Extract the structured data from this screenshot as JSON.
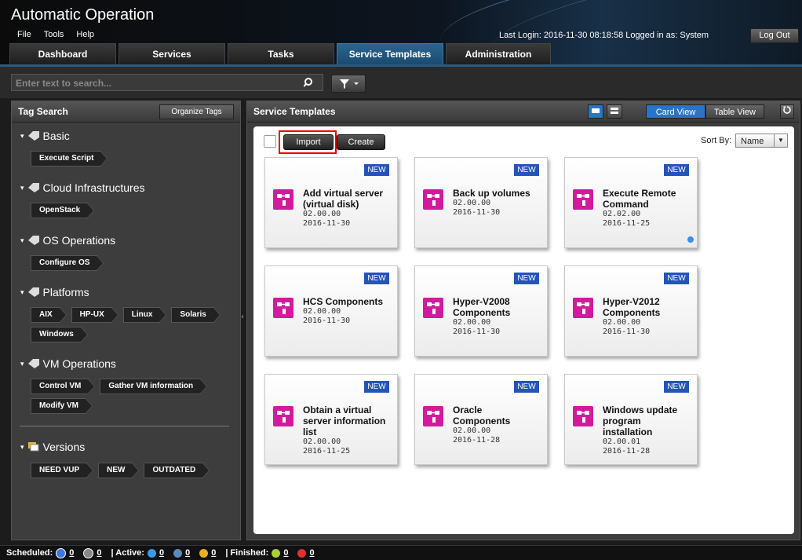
{
  "app": {
    "title": "Automatic Operation",
    "menu": [
      "File",
      "Tools",
      "Help"
    ],
    "last_login": "Last Login: 2016-11-30 08:18:58  Logged in as: System",
    "logout_label": "Log Out"
  },
  "tabs": [
    {
      "label": "Dashboard",
      "active": false
    },
    {
      "label": "Services",
      "active": false
    },
    {
      "label": "Tasks",
      "active": false
    },
    {
      "label": "Service Templates",
      "active": true
    },
    {
      "label": "Administration",
      "active": false
    }
  ],
  "search": {
    "placeholder": "Enter text to search..."
  },
  "tag_search": {
    "title": "Tag Search",
    "organize_label": "Organize Tags",
    "categories": [
      {
        "name": "Basic",
        "tags": [
          "Execute Script"
        ]
      },
      {
        "name": "Cloud Infrastructures",
        "tags": [
          "OpenStack"
        ]
      },
      {
        "name": "OS Operations",
        "tags": [
          "Configure OS"
        ]
      },
      {
        "name": "Platforms",
        "tags": [
          "AIX",
          "HP-UX",
          "Linux",
          "Solaris",
          "Windows"
        ]
      },
      {
        "name": "VM Operations",
        "tags": [
          "Control VM",
          "Gather VM information",
          "Modify VM"
        ]
      }
    ],
    "versions": {
      "name": "Versions",
      "tags": [
        "NEED VUP",
        "NEW",
        "OUTDATED"
      ]
    }
  },
  "templates": {
    "title": "Service Templates",
    "card_view_label": "Card View",
    "table_view_label": "Table View",
    "import_label": "Import",
    "create_label": "Create",
    "sort_by_label": "Sort By:",
    "sort_value": "Name",
    "cards": [
      {
        "badge": "NEW",
        "title": "Add virtual server (virtual disk)",
        "version": "02.00.00",
        "date": "2016-11-30",
        "dot": false
      },
      {
        "badge": "NEW",
        "title": "Back up volumes",
        "version": "02.00.00",
        "date": "2016-11-30",
        "dot": false
      },
      {
        "badge": "NEW",
        "title": "Execute Remote Command",
        "version": "02.02.00",
        "date": "2016-11-25",
        "dot": true
      },
      {
        "badge": "NEW",
        "title": "HCS Components",
        "version": "02.00.00",
        "date": "2016-11-30",
        "dot": false
      },
      {
        "badge": "NEW",
        "title": "Hyper-V2008 Components",
        "version": "02.00.00",
        "date": "2016-11-30",
        "dot": false
      },
      {
        "badge": "NEW",
        "title": "Hyper-V2012 Components",
        "version": "02.00.00",
        "date": "2016-11-30",
        "dot": false
      },
      {
        "badge": "NEW",
        "title": "Obtain a virtual server information list",
        "version": "02.00.00",
        "date": "2016-11-25",
        "dot": false
      },
      {
        "badge": "NEW",
        "title": "Oracle Components",
        "version": "02.00.00",
        "date": "2016-11-28",
        "dot": false
      },
      {
        "badge": "NEW",
        "title": "Windows update program installation",
        "version": "02.00.01",
        "date": "2016-11-28",
        "dot": false
      }
    ]
  },
  "status": {
    "scheduled_label": "Scheduled:",
    "active_label": "| Active:",
    "finished_label": "| Finished:",
    "scheduled_count": "0",
    "paused_count": "0",
    "active_running_count": "0",
    "active_waiting_count": "0",
    "active_warning_count": "0",
    "finished_ok_count": "0",
    "finished_error_count": "0"
  },
  "colors": {
    "accent": "#2b6590",
    "badge": "#2554b8",
    "template_icon": "#d41a9c"
  }
}
